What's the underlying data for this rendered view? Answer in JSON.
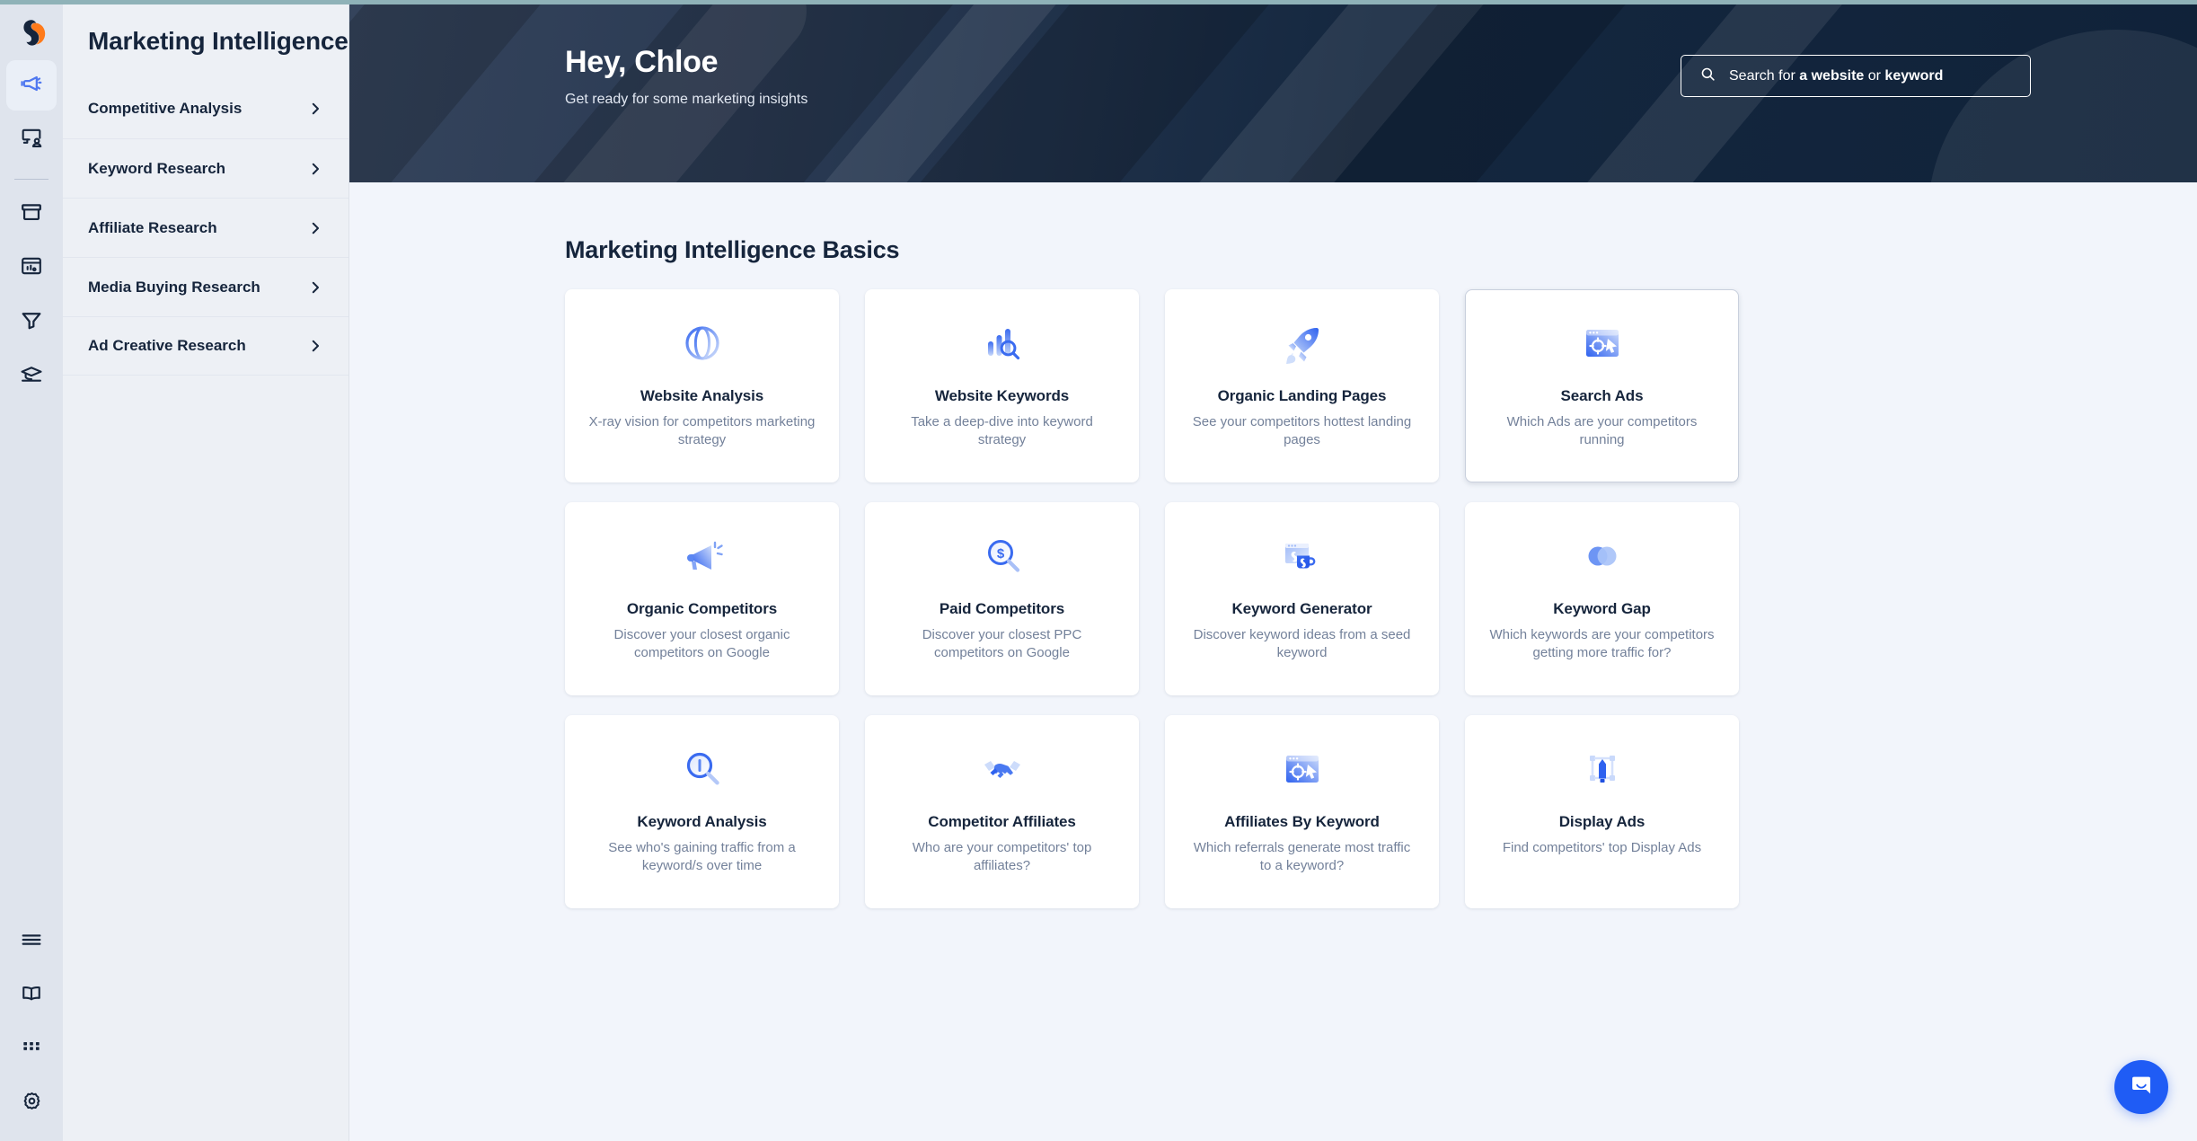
{
  "brand": {
    "name": "Similarweb",
    "accent": "#1f5cf5",
    "navy": "#16253c",
    "orange": "#ff7a1a"
  },
  "rail": {
    "logo_icon": "similarweb-logo-icon",
    "items": [
      {
        "icon": "megaphone-icon",
        "name": "marketing-intelligence",
        "active": true
      },
      {
        "icon": "audience-screen-icon",
        "name": "audience-intelligence",
        "active": false
      },
      {
        "icon": "box-archive-icon",
        "name": "shopper-intelligence",
        "active": false
      },
      {
        "icon": "browser-chart-icon",
        "name": "ad-intelligence",
        "active": false
      },
      {
        "icon": "funnel-icon",
        "name": "sales-intelligence",
        "active": false
      },
      {
        "icon": "graduation-cap-icon",
        "name": "academy",
        "active": false
      }
    ],
    "bottom_items": [
      {
        "icon": "hamburger-menu-icon",
        "name": "menu"
      },
      {
        "icon": "open-book-icon",
        "name": "knowledge-center"
      },
      {
        "icon": "grid-apps-icon",
        "name": "apps"
      },
      {
        "icon": "gear-icon",
        "name": "settings"
      }
    ]
  },
  "sidebar": {
    "title": "Marketing Intelligence",
    "items": [
      {
        "label": "Competitive Analysis"
      },
      {
        "label": "Keyword Research"
      },
      {
        "label": "Affiliate Research"
      },
      {
        "label": "Media Buying Research"
      },
      {
        "label": "Ad Creative Research"
      }
    ]
  },
  "hero": {
    "greeting": "Hey, Chloe",
    "subtitle": "Get ready for some marketing insights",
    "search": {
      "icon": "search-icon",
      "prefix": "Search for ",
      "bold1": "a website",
      "middle": " or ",
      "bold2": "keyword"
    }
  },
  "main": {
    "section_title": "Marketing Intelligence Basics",
    "cards": [
      {
        "title": "Website Analysis",
        "desc": "X-ray vision for competitors marketing strategy",
        "icon": "globe-icon",
        "hovered": false
      },
      {
        "title": "Website Keywords",
        "desc": "Take a deep-dive into keyword strategy",
        "icon": "bar-chart-search-icon",
        "hovered": false
      },
      {
        "title": "Organic Landing Pages",
        "desc": "See your competitors hottest landing pages",
        "icon": "rocket-icon",
        "hovered": false
      },
      {
        "title": "Search Ads",
        "desc": "Which Ads are your competitors running",
        "icon": "browser-target-cursor-icon",
        "hovered": true
      },
      {
        "title": "Organic Competitors",
        "desc": "Discover your closest organic competitors on Google",
        "icon": "megaphone-icon",
        "hovered": false
      },
      {
        "title": "Paid Competitors",
        "desc": "Discover your closest PPC competitors on Google",
        "icon": "dollar-magnifier-icon",
        "hovered": false
      },
      {
        "title": "Keyword Generator",
        "desc": "Discover keyword ideas from a seed keyword",
        "icon": "browser-mug-icon",
        "hovered": false
      },
      {
        "title": "Keyword Gap",
        "desc": "Which keywords are your competitors getting more traffic for?",
        "icon": "venn-circles-icon",
        "hovered": false
      },
      {
        "title": "Keyword Analysis",
        "desc": "See who's gaining traffic from a keyword/s over time",
        "icon": "magnifier-bar-icon",
        "hovered": false
      },
      {
        "title": "Competitor Affiliates",
        "desc": "Who are your competitors' top affiliates?",
        "icon": "handshake-icon",
        "hovered": false
      },
      {
        "title": "Affiliates By Keyword",
        "desc": "Which referrals generate most traffic to a keyword?",
        "icon": "browser-target-cursor-icon",
        "hovered": false
      },
      {
        "title": "Display Ads",
        "desc": "Find competitors' top Display Ads",
        "icon": "display-banner-icon",
        "hovered": false
      }
    ]
  },
  "intercom": {
    "icon": "chat-bubble-smile-icon",
    "label": "Open chat"
  }
}
